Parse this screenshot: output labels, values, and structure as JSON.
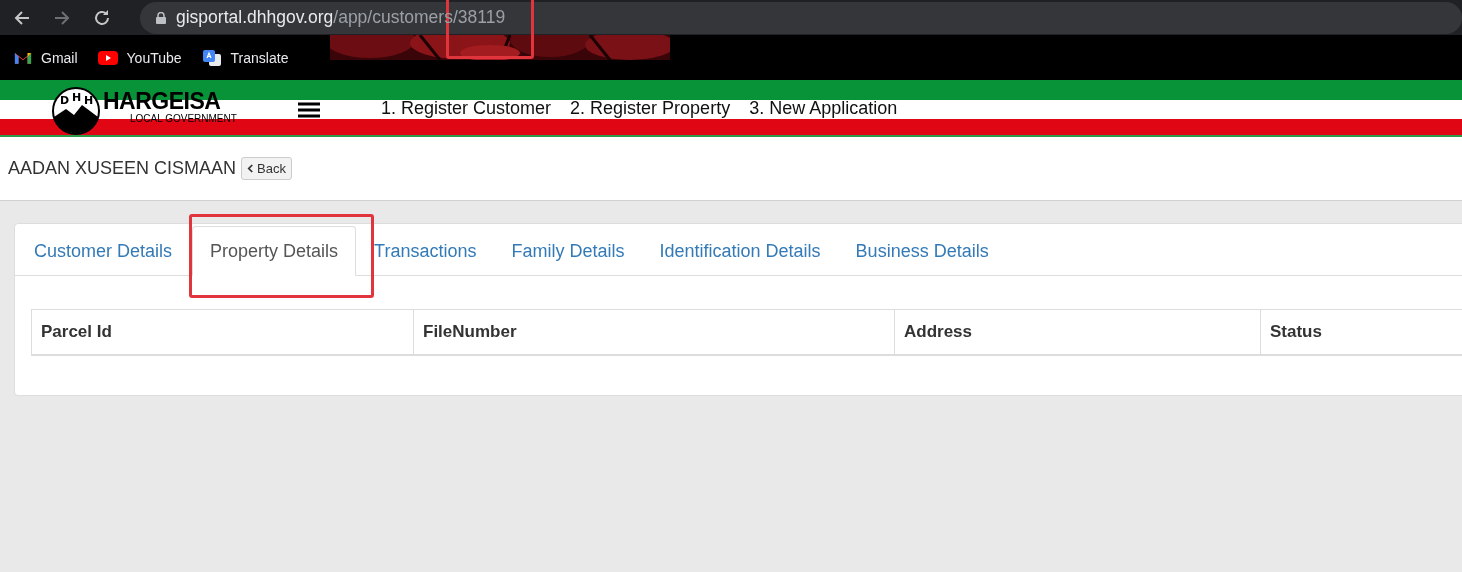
{
  "browser": {
    "url_host": "gisportal.dhhgov.org",
    "url_path": "/app/customers/38119",
    "bookmarks": [
      {
        "kind": "gmail",
        "label": "Gmail"
      },
      {
        "kind": "youtube",
        "label": "YouTube"
      },
      {
        "kind": "translate",
        "label": "Translate"
      }
    ]
  },
  "header": {
    "logo_letters": [
      "D",
      "H",
      "H"
    ],
    "logo_title": "HARGEISA",
    "logo_subtitle": "LOCAL GOVERNMENT",
    "nav": [
      "1. Register Customer",
      "2. Register Property",
      "3. New Application"
    ]
  },
  "customer": {
    "name": "AADAN XUSEEN CISMAAN",
    "back_label": "Back"
  },
  "tabs": [
    {
      "label": "Customer Details",
      "selected": false
    },
    {
      "label": "Property Details",
      "selected": true
    },
    {
      "label": "Transactions",
      "selected": false
    },
    {
      "label": "Family Details",
      "selected": false
    },
    {
      "label": "Identification Details",
      "selected": false
    },
    {
      "label": "Business Details",
      "selected": false
    }
  ],
  "table": {
    "columns": [
      "Parcel Id",
      "FileNumber",
      "Address",
      "Status"
    ]
  }
}
